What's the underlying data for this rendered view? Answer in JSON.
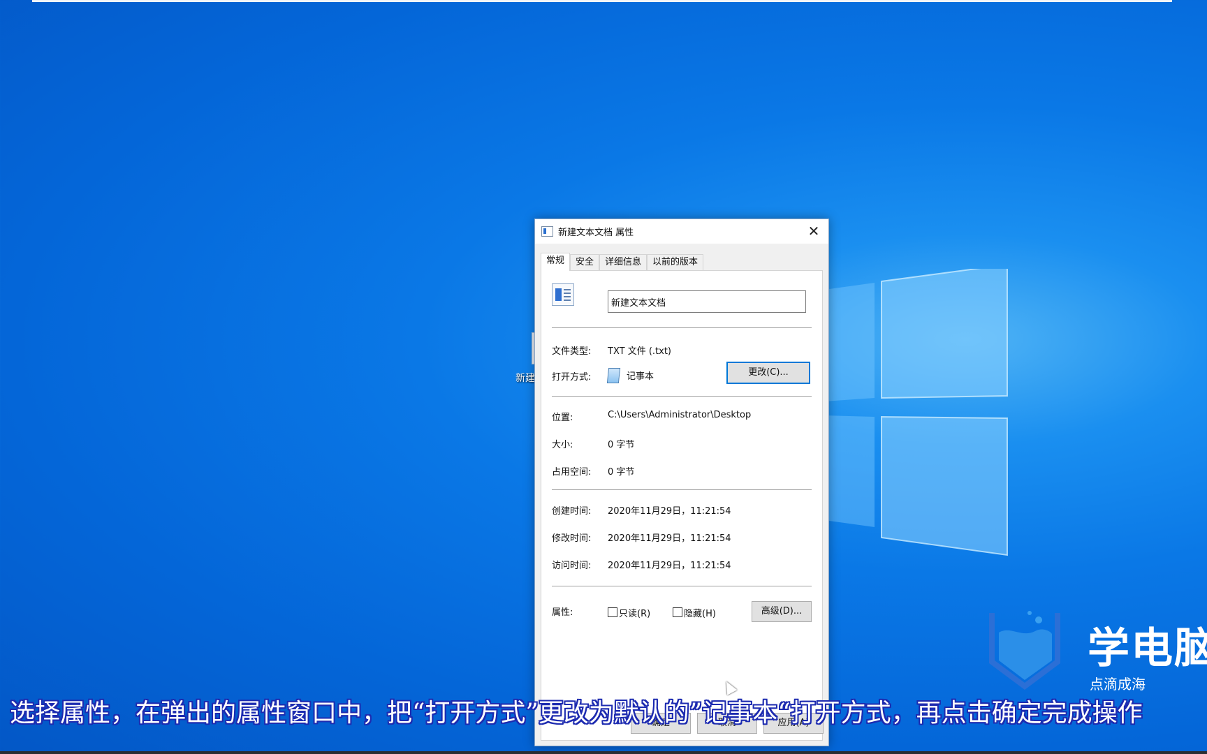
{
  "desktop": {
    "partial_icon_label": "新建"
  },
  "dialog": {
    "title": "新建文本文档 属性",
    "close_glyph": "✕",
    "tabs": [
      {
        "label": "常规"
      },
      {
        "label": "安全"
      },
      {
        "label": "详细信息"
      },
      {
        "label": "以前的版本"
      }
    ],
    "file_name": "新建文本文档",
    "file_type_label": "文件类型:",
    "file_type_value": "TXT 文件 (.txt)",
    "open_with_label": "打开方式:",
    "open_with_value": "记事本",
    "change_button": "更改(C)...",
    "location_label": "位置:",
    "location_value": "C:\\Users\\Administrator\\Desktop",
    "size_label": "大小:",
    "size_value": "0 字节",
    "disk_size_label": "占用空间:",
    "disk_size_value": "0 字节",
    "created_label": "创建时间:",
    "created_value": "2020年11月29日，11:21:54",
    "modified_label": "修改时间:",
    "modified_value": "2020年11月29日，11:21:54",
    "accessed_label": "访问时间:",
    "accessed_value": "2020年11月29日，11:21:54",
    "attributes_label": "属性:",
    "readonly_label": "只读(R)",
    "hidden_label": "隐藏(H)",
    "advanced_button": "高级(D)...",
    "ok_button": "确定",
    "cancel_button": "取消",
    "apply_button": "应用(A)"
  },
  "watermark": {
    "title": "学电脑",
    "subtitle": "点滴成海"
  },
  "subtitle": "选择属性，在弹出的属性窗口中，把“打开方式”更改为默认的”记事本“打开方式，再点击确定完成操作",
  "colors": {
    "accent": "#0078d7",
    "desktop_blue": "#0a78e6",
    "subtitle_outline": "#1d2bb0"
  }
}
